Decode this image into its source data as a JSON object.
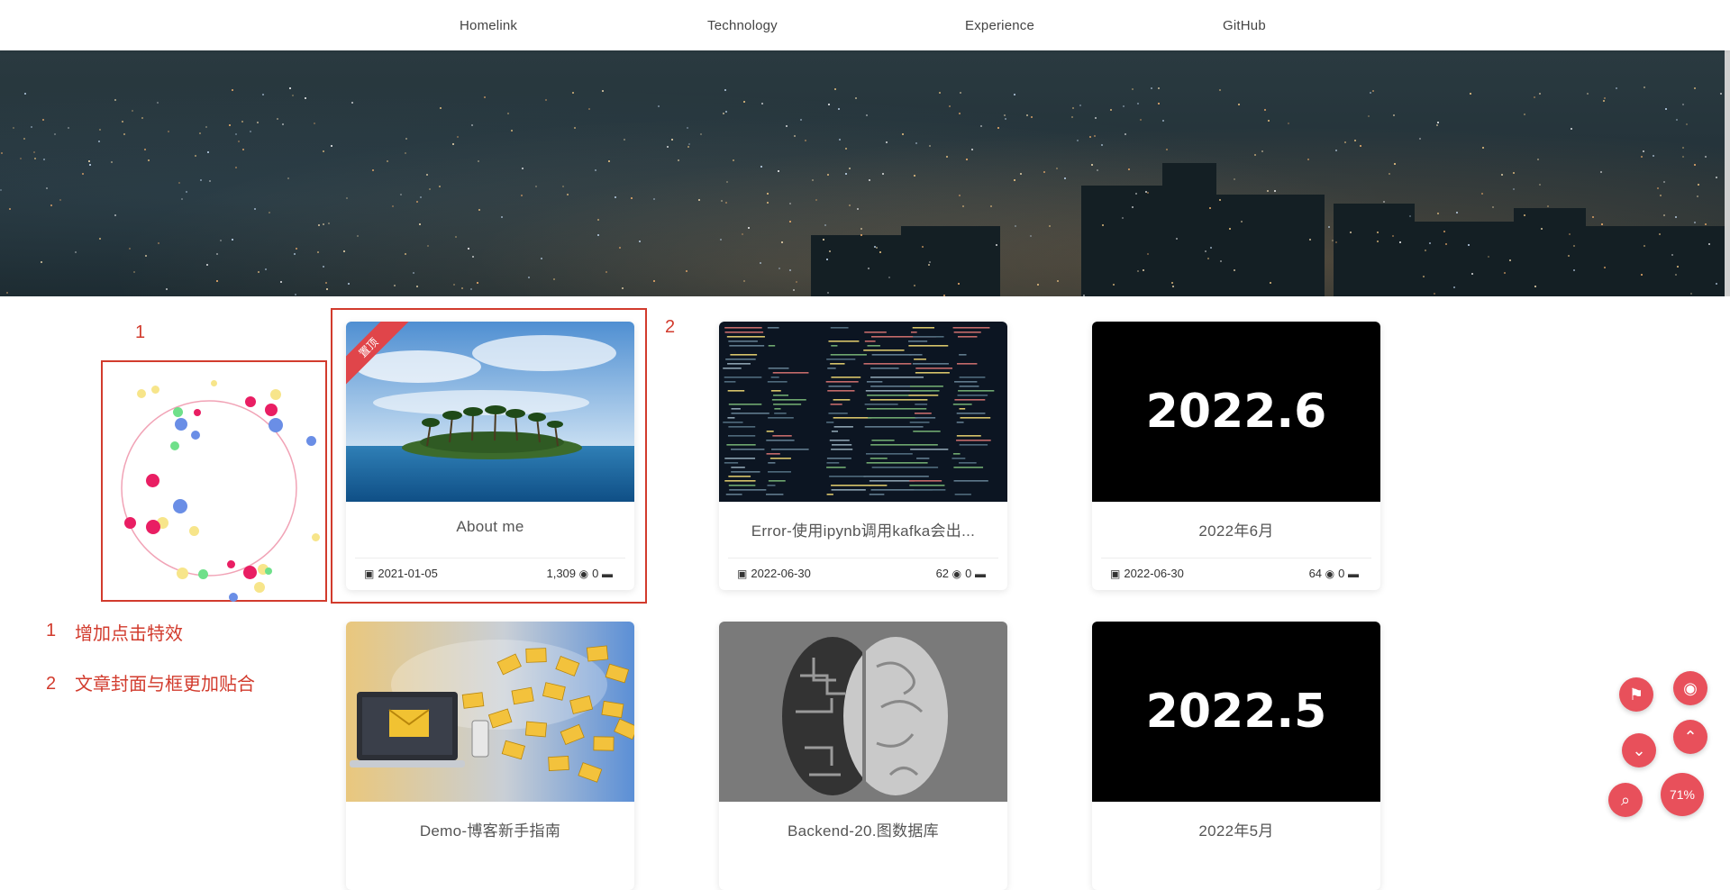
{
  "nav": {
    "items": [
      {
        "label": "Homelink"
      },
      {
        "label": "Technology"
      },
      {
        "label": "Experience"
      },
      {
        "label": "GitHub"
      }
    ]
  },
  "annotations": {
    "label_1": "1",
    "label_2": "2",
    "notes": [
      {
        "num": "1",
        "text": "增加点击特效"
      },
      {
        "num": "2",
        "text": "文章封面与框更加贴合"
      }
    ]
  },
  "posts": [
    {
      "title": "About me",
      "date": "2021-01-05",
      "views": "1,309",
      "comments": "0",
      "pinned_label": "置顶"
    },
    {
      "title": "Error-使用ipynb调用kafka会出...",
      "date": "2022-06-30",
      "views": "62",
      "comments": "0"
    },
    {
      "title": "2022年6月",
      "date": "2022-06-30",
      "views": "64",
      "comments": "0",
      "cover_text": "2022.6"
    },
    {
      "title": "Demo-博客新手指南"
    },
    {
      "title": "Backend-20.图数据库"
    },
    {
      "title": "2022年5月",
      "cover_text": "2022.5"
    }
  ],
  "reading_progress": "71%",
  "colors": {
    "accent": "#e8505b",
    "annotation": "#d23b2d"
  },
  "icons": [
    "calendar-icon",
    "eye-icon",
    "comment-icon",
    "gift-icon",
    "reading-mode-icon",
    "scroll-down-icon",
    "scroll-up-icon",
    "search-icon"
  ]
}
